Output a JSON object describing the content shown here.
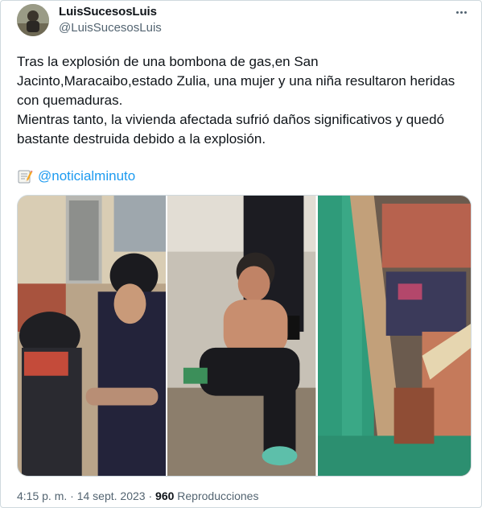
{
  "author": {
    "display_name": "LuisSucesosLuis",
    "handle": "@LuisSucesosLuis"
  },
  "tweet": {
    "paragraph_1": "Tras la explosión de una bombona de gas,en San Jacinto,Maracaibo,estado Zulia, una mujer y una niña resultaron heridas con quemaduras.",
    "paragraph_2": "Mientras tanto, la vivienda afectada sufrió daños significativos y quedó bastante destruida debido a la explosión.",
    "credit_icon": "memo-icon",
    "credit_mention": "@noticialminuto"
  },
  "media": {
    "photo_count": 3
  },
  "meta": {
    "time": "4:15 p. m.",
    "separator": "·",
    "date": "14 sept. 2023",
    "view_count": "960",
    "view_label": "Reproducciones"
  },
  "icons": {
    "more": "more-options-icon"
  },
  "colors": {
    "link": "#1d9bf0",
    "secondary_text": "#536471",
    "primary_text": "#0f1419",
    "border": "#cfd9de"
  }
}
